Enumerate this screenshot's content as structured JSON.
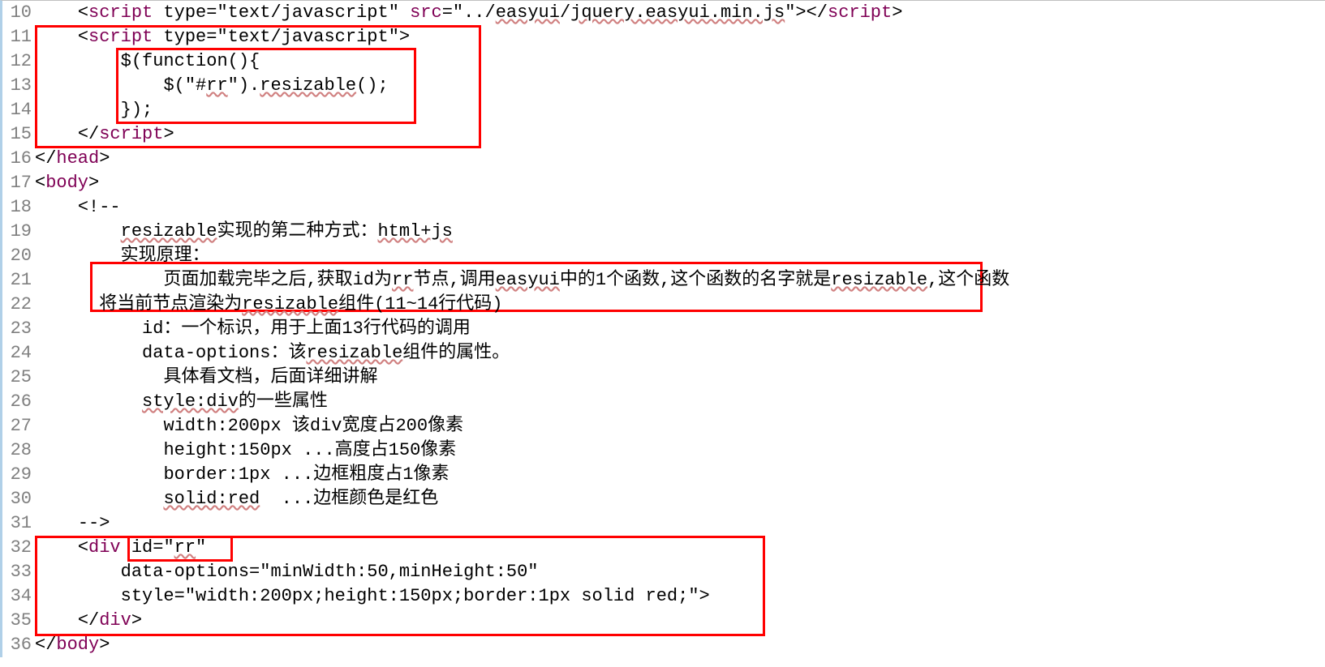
{
  "lines": [
    {
      "n": "10",
      "indent": "    ",
      "segs": [
        {
          "t": "<",
          "c": "txt"
        },
        {
          "t": "script",
          "c": "kw"
        },
        {
          "t": " type=",
          "c": "txt"
        },
        {
          "t": "\"text/javascript\"",
          "c": "txt"
        },
        {
          "t": " ",
          "c": "txt"
        },
        {
          "t": "src",
          "c": "kw"
        },
        {
          "t": "=",
          "c": "txt"
        },
        {
          "t": "\"../",
          "c": "txt"
        },
        {
          "t": "easyui",
          "c": "txt sq"
        },
        {
          "t": "/",
          "c": "txt"
        },
        {
          "t": "jquery.easyui.min.js",
          "c": "txt sq"
        },
        {
          "t": "\"></",
          "c": "txt"
        },
        {
          "t": "script",
          "c": "kw"
        },
        {
          "t": ">",
          "c": "txt"
        }
      ]
    },
    {
      "n": "11",
      "indent": "    ",
      "segs": [
        {
          "t": "<",
          "c": "txt"
        },
        {
          "t": "script",
          "c": "kw"
        },
        {
          "t": " type=",
          "c": "txt"
        },
        {
          "t": "\"text/javascript\"",
          "c": "txt"
        },
        {
          "t": ">",
          "c": "txt"
        }
      ]
    },
    {
      "n": "12",
      "indent": "        ",
      "segs": [
        {
          "t": "$(function(){",
          "c": "txt"
        }
      ]
    },
    {
      "n": "13",
      "indent": "            ",
      "segs": [
        {
          "t": "$(\"#",
          "c": "txt"
        },
        {
          "t": "rr",
          "c": "txt sq"
        },
        {
          "t": "\").",
          "c": "txt"
        },
        {
          "t": "resizable",
          "c": "txt sq"
        },
        {
          "t": "();",
          "c": "txt"
        }
      ]
    },
    {
      "n": "14",
      "indent": "        ",
      "segs": [
        {
          "t": "});",
          "c": "txt"
        }
      ]
    },
    {
      "n": "15",
      "indent": "    ",
      "segs": [
        {
          "t": "</",
          "c": "txt"
        },
        {
          "t": "script",
          "c": "kw"
        },
        {
          "t": ">",
          "c": "txt"
        }
      ]
    },
    {
      "n": "16",
      "indent": "",
      "segs": [
        {
          "t": "</",
          "c": "txt"
        },
        {
          "t": "head",
          "c": "kw"
        },
        {
          "t": ">",
          "c": "txt"
        }
      ]
    },
    {
      "n": "17",
      "indent": "",
      "segs": [
        {
          "t": "<",
          "c": "txt"
        },
        {
          "t": "body",
          "c": "kw"
        },
        {
          "t": ">",
          "c": "txt"
        }
      ]
    },
    {
      "n": "18",
      "indent": "    ",
      "segs": [
        {
          "t": "<!--",
          "c": "txt"
        }
      ]
    },
    {
      "n": "19",
      "indent": "        ",
      "segs": [
        {
          "t": "resizable",
          "c": "txt sq"
        },
        {
          "t": "实现的第二种方式：",
          "c": "txt"
        },
        {
          "t": "html+js",
          "c": "txt sq"
        }
      ]
    },
    {
      "n": "20",
      "indent": "        ",
      "segs": [
        {
          "t": "实现原理：",
          "c": "txt"
        }
      ]
    },
    {
      "n": "21",
      "indent": "            ",
      "segs": [
        {
          "t": "页面加载完毕之后,获取id为",
          "c": "txt"
        },
        {
          "t": "rr",
          "c": "txt sq"
        },
        {
          "t": "节点,调用",
          "c": "txt"
        },
        {
          "t": "easyui",
          "c": "txt sq"
        },
        {
          "t": "中的1个函数,这个函数的名字就是",
          "c": "txt"
        },
        {
          "t": "resizable",
          "c": "txt sq"
        },
        {
          "t": ",这个函数",
          "c": "txt"
        }
      ]
    },
    {
      "n": "22",
      "indent": "      ",
      "segs": [
        {
          "t": "将当前节点渲染为",
          "c": "txt"
        },
        {
          "t": "resizable",
          "c": "txt sq"
        },
        {
          "t": "组件(11~14行代码)",
          "c": "txt"
        }
      ]
    },
    {
      "n": "23",
      "indent": "          ",
      "segs": [
        {
          "t": "id：一个标识，用于上面13行代码的调用",
          "c": "txt"
        }
      ]
    },
    {
      "n": "24",
      "indent": "          ",
      "segs": [
        {
          "t": "data-options：该",
          "c": "txt"
        },
        {
          "t": "resizable",
          "c": "txt sq"
        },
        {
          "t": "组件的属性。",
          "c": "txt"
        }
      ]
    },
    {
      "n": "25",
      "indent": "            ",
      "segs": [
        {
          "t": "具体看文档，后面详细讲解",
          "c": "txt"
        }
      ]
    },
    {
      "n": "26",
      "indent": "          ",
      "segs": [
        {
          "t": "style:div",
          "c": "txt sq"
        },
        {
          "t": "的一些属性",
          "c": "txt"
        }
      ]
    },
    {
      "n": "27",
      "indent": "            ",
      "segs": [
        {
          "t": "width:200px 该div宽度占200像素",
          "c": "txt"
        }
      ]
    },
    {
      "n": "28",
      "indent": "            ",
      "segs": [
        {
          "t": "height:150px ...高度占150像素",
          "c": "txt"
        }
      ]
    },
    {
      "n": "29",
      "indent": "            ",
      "segs": [
        {
          "t": "border:1px ...边框粗度占1像素",
          "c": "txt"
        }
      ]
    },
    {
      "n": "30",
      "indent": "            ",
      "segs": [
        {
          "t": "solid:red",
          "c": "txt sq"
        },
        {
          "t": "  ...边框颜色是红色",
          "c": "txt"
        }
      ]
    },
    {
      "n": "31",
      "indent": "    ",
      "segs": [
        {
          "t": "-->",
          "c": "txt"
        }
      ]
    },
    {
      "n": "32",
      "indent": "    ",
      "segs": [
        {
          "t": "<",
          "c": "txt"
        },
        {
          "t": "div",
          "c": "kw"
        },
        {
          "t": " id=",
          "c": "txt"
        },
        {
          "t": "\"",
          "c": "txt"
        },
        {
          "t": "rr",
          "c": "txt sq"
        },
        {
          "t": "\"",
          "c": "txt"
        }
      ]
    },
    {
      "n": "33",
      "indent": "        ",
      "segs": [
        {
          "t": "data-options=\"minWidth:50,minHeight:50\"",
          "c": "txt"
        }
      ]
    },
    {
      "n": "34",
      "indent": "        ",
      "segs": [
        {
          "t": "style=\"width:200px;height:150px;border:1px solid red;\">",
          "c": "txt"
        }
      ]
    },
    {
      "n": "35",
      "indent": "    ",
      "segs": [
        {
          "t": "</",
          "c": "txt"
        },
        {
          "t": "div",
          "c": "kw"
        },
        {
          "t": ">",
          "c": "txt"
        }
      ]
    },
    {
      "n": "36",
      "indent": "",
      "segs": [
        {
          "t": "</",
          "c": "txt"
        },
        {
          "t": "body",
          "c": "kw"
        },
        {
          "t": ">",
          "c": "txt"
        }
      ]
    }
  ]
}
